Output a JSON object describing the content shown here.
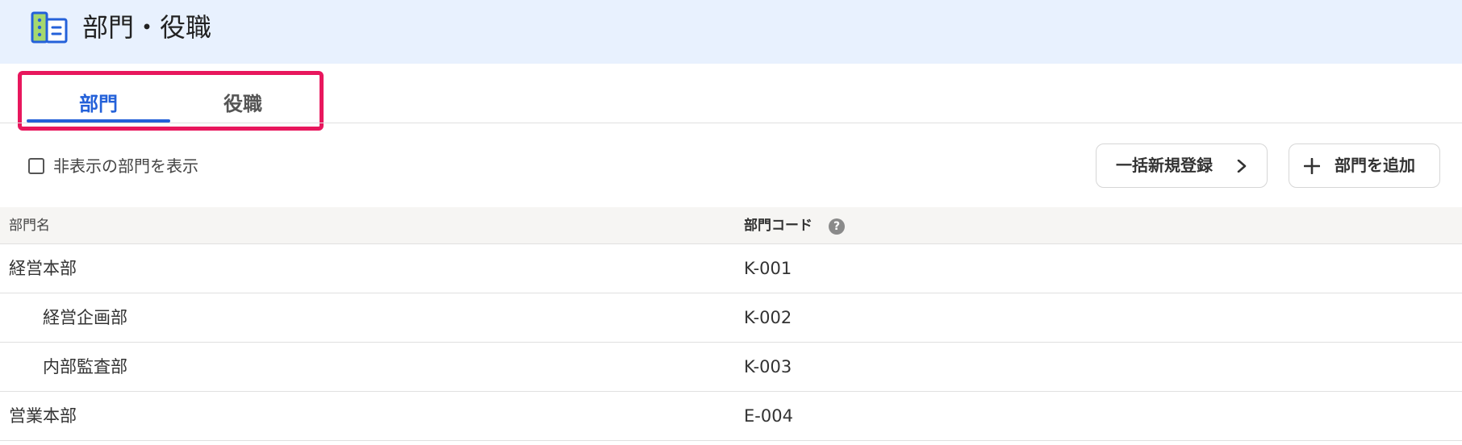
{
  "header": {
    "title": "部門・役職",
    "icon": "building-icon"
  },
  "tabs": [
    {
      "label": "部門",
      "active": true
    },
    {
      "label": "役職",
      "active": false
    }
  ],
  "toolbar": {
    "show_hidden_label": "非表示の部門を表示",
    "show_hidden_checked": false,
    "bulk_register_label": "一括新規登録",
    "add_department_label": "部門を追加"
  },
  "table": {
    "columns": {
      "name": "部門名",
      "code": "部門コード"
    },
    "rows": [
      {
        "name": "経営本部",
        "code": "K-001",
        "level": 0
      },
      {
        "name": "経営企画部",
        "code": "K-002",
        "level": 1
      },
      {
        "name": "内部監査部",
        "code": "K-003",
        "level": 1
      },
      {
        "name": "営業本部",
        "code": "E-004",
        "level": 0
      }
    ]
  },
  "colors": {
    "header_bg": "#e8f1fe",
    "accent": "#2461d9",
    "highlight": "#e8175d",
    "table_head_bg": "#f6f5f3"
  }
}
